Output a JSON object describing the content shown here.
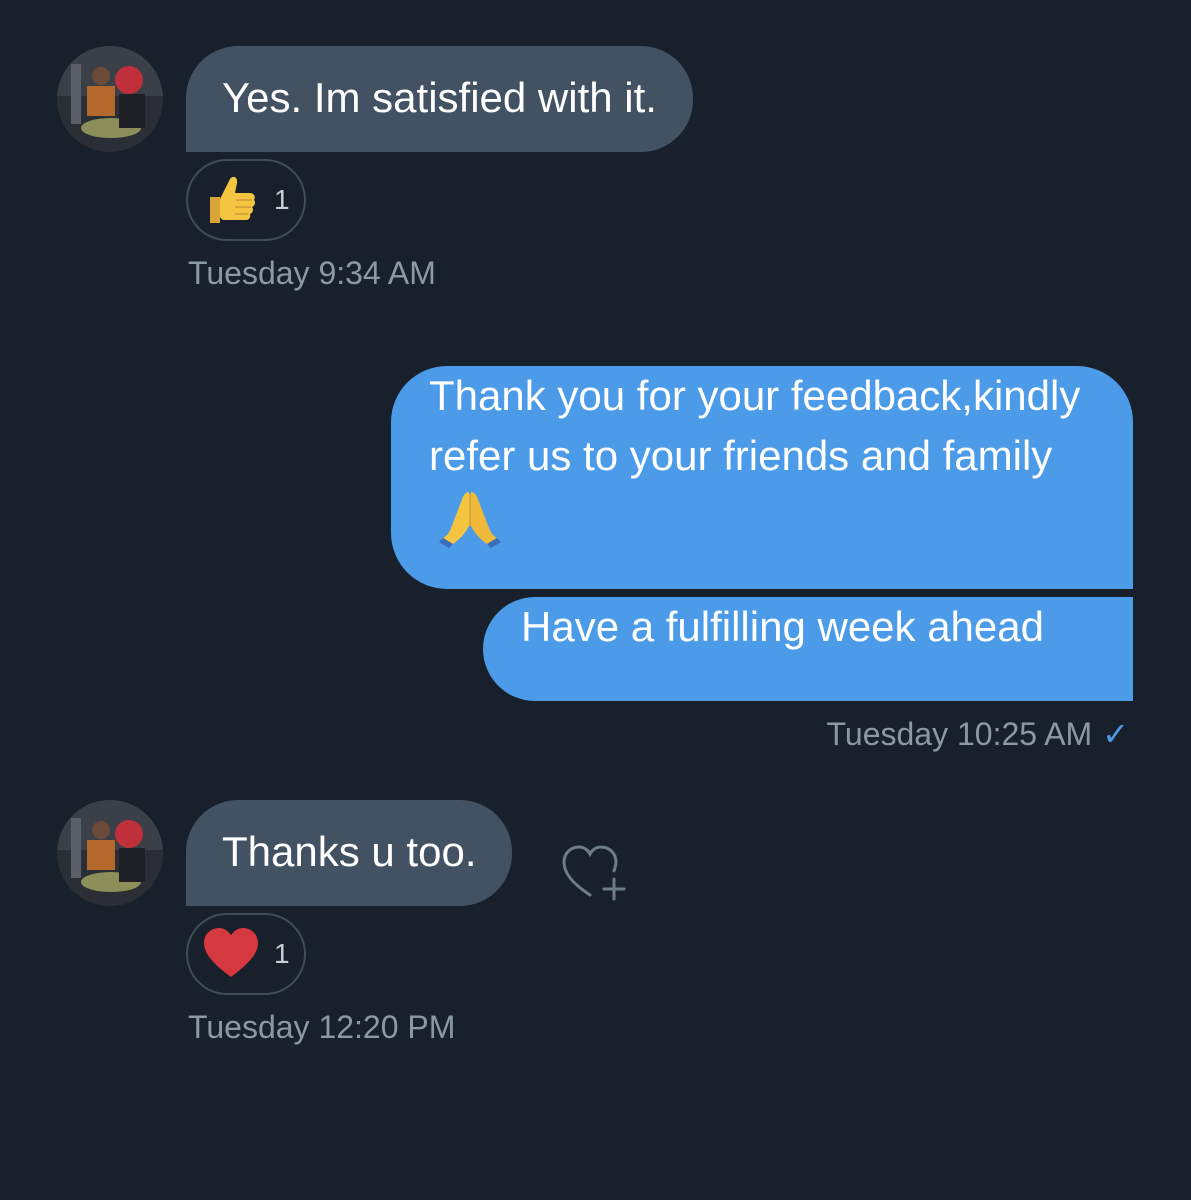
{
  "messages": [
    {
      "id": "msg1",
      "direction": "incoming",
      "text": "Yes. Im satisfied with it.",
      "reaction": {
        "emoji": "thumbs-up-icon",
        "count": "1"
      },
      "timestamp": "Tuesday 9:34 AM"
    },
    {
      "id": "msg2",
      "direction": "outgoing",
      "text": "Thank you for your feedback,kindly refer us to your friends and family",
      "emoji": "folded-hands-icon"
    },
    {
      "id": "msg3",
      "direction": "outgoing",
      "text": "Have a fulfilling week ahead",
      "timestamp": "Tuesday 10:25 AM",
      "status": "✓"
    },
    {
      "id": "msg4",
      "direction": "incoming",
      "text": "Thanks u too.",
      "reaction": {
        "emoji": "heart-icon",
        "count": "1"
      },
      "timestamp": "Tuesday 12:20 PM",
      "add_reaction_icon": "heart-plus-icon"
    }
  ],
  "colors": {
    "background": "#17202b",
    "incoming_bubble": "#425263",
    "outgoing_bubble": "#4b9be9",
    "timestamp": "#8b98a5",
    "read_check": "#4b9be9"
  }
}
